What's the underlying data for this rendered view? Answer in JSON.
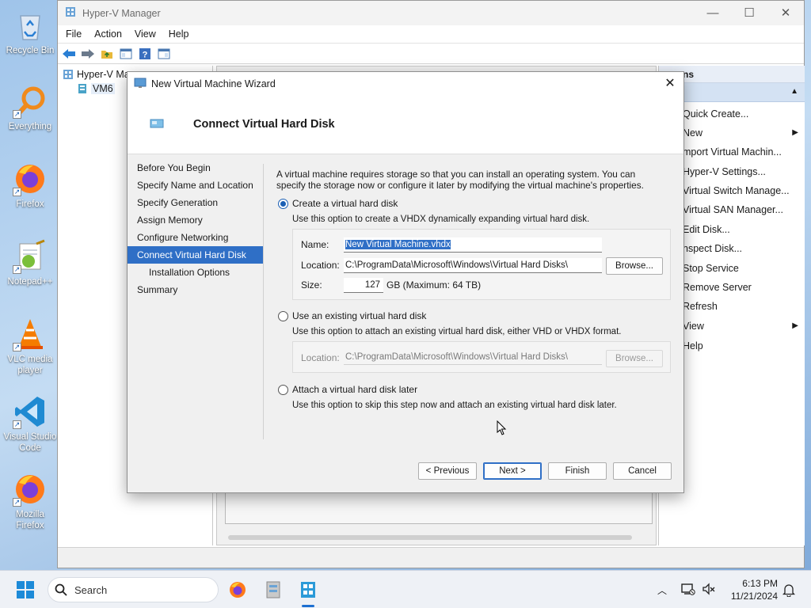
{
  "desktop": {
    "icons": [
      {
        "label": "Recycle Bin"
      },
      {
        "label": "Everything"
      },
      {
        "label": "Firefox"
      },
      {
        "label": "Notepad++"
      },
      {
        "label": "VLC media player"
      },
      {
        "label": "Visual Studio Code"
      },
      {
        "label": "Mozilla Firefox"
      }
    ]
  },
  "main_window": {
    "title": "Hyper-V Manager",
    "menu": [
      "File",
      "Action",
      "View",
      "Help"
    ],
    "tree": {
      "root": "Hyper-V Ma",
      "child": "VM6"
    },
    "actions": {
      "header": "ns",
      "items": [
        "Quick Create...",
        "New",
        "mport Virtual Machin...",
        "Hyper-V Settings...",
        "Virtual Switch Manage...",
        "Virtual SAN Manager...",
        "Edit Disk...",
        "nspect Disk...",
        "Stop Service",
        "Remove Server",
        "Refresh",
        "View",
        "Help"
      ]
    }
  },
  "dialog": {
    "title": "New Virtual Machine Wizard",
    "heading": "Connect Virtual Hard Disk",
    "steps": [
      "Before You Begin",
      "Specify Name and Location",
      "Specify Generation",
      "Assign Memory",
      "Configure Networking",
      "Connect Virtual Hard Disk",
      "Installation Options",
      "Summary"
    ],
    "active_step": "Connect Virtual Hard Disk",
    "intro": "A virtual machine requires storage so that you can install an operating system. You can specify the storage now or configure it later by modifying the virtual machine's properties.",
    "option_create": {
      "label": "Create a virtual hard disk",
      "desc": "Use this option to create a VHDX dynamically expanding virtual hard disk.",
      "selected": true,
      "name_label": "Name:",
      "name_value": "New Virtual Machine.vhdx",
      "location_label": "Location:",
      "location_value": "C:\\ProgramData\\Microsoft\\Windows\\Virtual Hard Disks\\",
      "browse": "Browse...",
      "size_label": "Size:",
      "size_value": "127",
      "size_unit": "GB (Maximum: 64 TB)"
    },
    "option_existing": {
      "label": "Use an existing virtual hard disk",
      "desc": "Use this option to attach an existing virtual hard disk, either VHD or VHDX format.",
      "selected": false,
      "location_label": "Location:",
      "location_value": "C:\\ProgramData\\Microsoft\\Windows\\Virtual Hard Disks\\",
      "browse": "Browse..."
    },
    "option_later": {
      "label": "Attach a virtual hard disk later",
      "desc": "Use this option to skip this step now and attach an existing virtual hard disk later.",
      "selected": false
    },
    "buttons": {
      "previous": "< Previous",
      "next": "Next >",
      "finish": "Finish",
      "cancel": "Cancel"
    }
  },
  "taskbar": {
    "search_placeholder": "Search",
    "time": "6:13 PM",
    "date": "11/21/2024"
  },
  "colors": {
    "accent": "#2f6fc6",
    "taskbar": "#eef1f6"
  }
}
